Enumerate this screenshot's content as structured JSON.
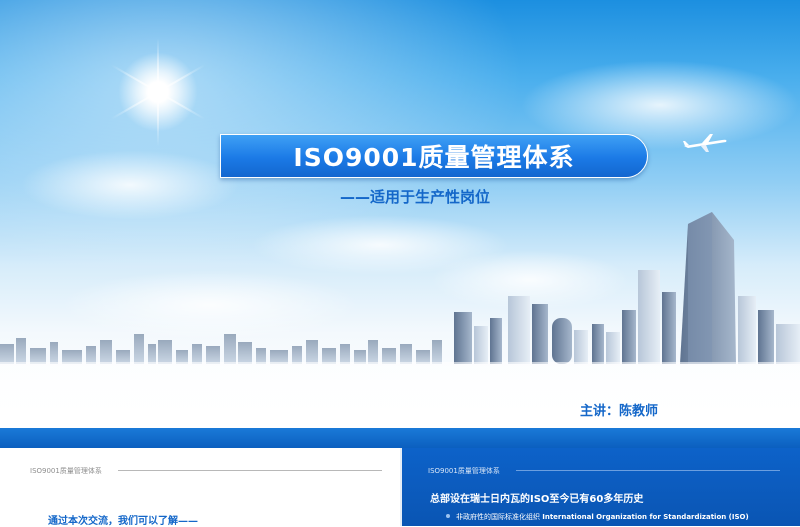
{
  "cover": {
    "title": "ISO9001质量管理体系",
    "subtitle": "——适用于生产性岗位",
    "presenter": "主讲：陈教师"
  },
  "slide_left": {
    "tag": "ISO9001质量管理体系",
    "heading": "通过本次交流，我们可以了解——"
  },
  "slide_right": {
    "tag": "ISO9001质量管理体系",
    "heading": "总部设在瑞士日内瓦的ISO至今已有60多年历史",
    "bullet_cn": "非政府性的国际标准化组织",
    "bullet_en": "International Organization for Standardization (ISO)"
  },
  "icons": {
    "sun": "sun-icon",
    "plane": "airplane-icon",
    "bullet": "bullet-dot-icon"
  },
  "colors": {
    "accent_blue": "#1467c9",
    "title_bar": "#1b7ae6",
    "band": "#0b5fbf"
  }
}
